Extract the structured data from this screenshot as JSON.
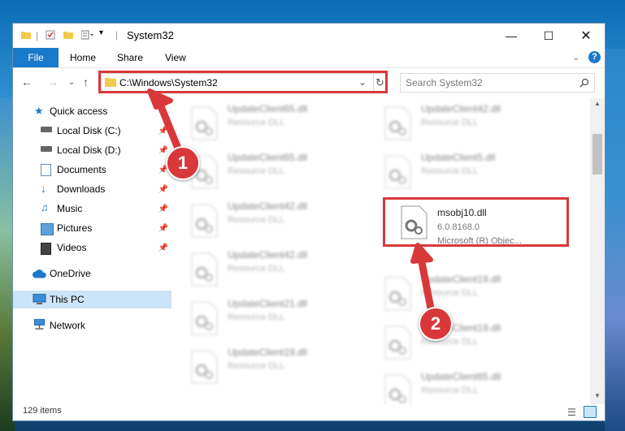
{
  "window": {
    "title": "System32"
  },
  "ribbon": {
    "tabs": [
      "File",
      "Home",
      "Share",
      "View"
    ]
  },
  "address": {
    "path": "C:\\Windows\\System32",
    "search_placeholder": "Search System32"
  },
  "nav": {
    "items": [
      {
        "label": "Quick access",
        "icon": "star-icon"
      },
      {
        "label": "Local Disk (C:)",
        "icon": "drive-icon",
        "pinned": true
      },
      {
        "label": "Local Disk (D:)",
        "icon": "drive-icon",
        "pinned": true
      },
      {
        "label": "Documents",
        "icon": "documents-icon",
        "pinned": true
      },
      {
        "label": "Downloads",
        "icon": "downloads-icon",
        "pinned": true
      },
      {
        "label": "Music",
        "icon": "music-icon",
        "pinned": true
      },
      {
        "label": "Pictures",
        "icon": "pictures-icon",
        "pinned": true
      },
      {
        "label": "Videos",
        "icon": "videos-icon",
        "pinned": true
      },
      {
        "label": "OneDrive",
        "icon": "cloud-icon"
      },
      {
        "label": "This PC",
        "icon": "computer-icon",
        "selected": true
      },
      {
        "label": "Network",
        "icon": "network-icon"
      }
    ]
  },
  "files": {
    "left": [
      {
        "name": "UpdateClient65.dll",
        "type": "Resource DLL"
      },
      {
        "name": "UpdateClient65.dll",
        "type": "Resource DLL"
      },
      {
        "name": "UpdateClient42.dll",
        "type": "Resource DLL"
      },
      {
        "name": "UpdateClient42.dll",
        "type": "Resource DLL"
      },
      {
        "name": "UpdateClient21.dll",
        "type": "Resource DLL"
      },
      {
        "name": "UpdateClient19.dll",
        "type": "Resource DLL"
      }
    ],
    "right": [
      {
        "name": "UpdateClient42.dll",
        "type": "Resource DLL"
      },
      {
        "name": "UpdateClient5.dll",
        "type": "Resource DLL"
      },
      {
        "name": "msobj10.dll",
        "type": "6.0.8168.0",
        "desc": "Microsoft (R) Objec...",
        "highlight": true
      },
      {
        "name": "UpdateClient19.dll",
        "type": "Resource DLL"
      },
      {
        "name": "UpdateClient19.dll",
        "type": "Resource DLL"
      },
      {
        "name": "UpdateClient65.dll",
        "type": "Resource DLL"
      }
    ]
  },
  "status": {
    "items": "129 items"
  },
  "annotations": {
    "badge1": "1",
    "badge2": "2",
    "color": "#d9383a"
  }
}
